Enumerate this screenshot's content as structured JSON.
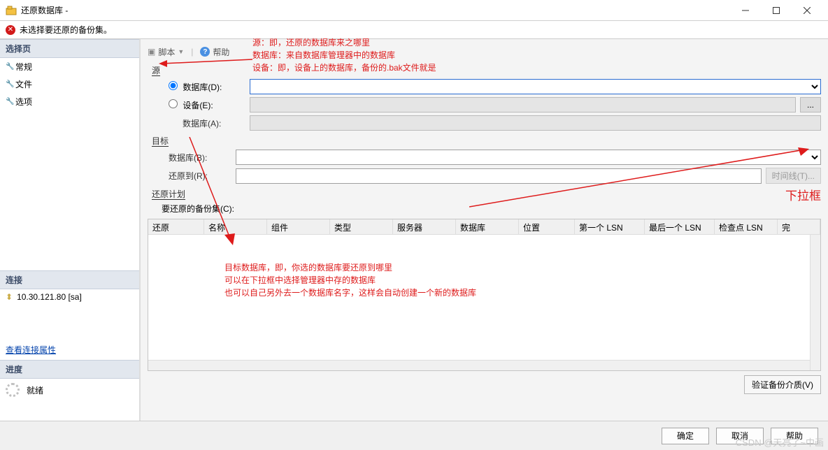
{
  "title": "还原数据库 -",
  "error_bar": "未选择要还原的备份集。",
  "sidebar": {
    "select_page": "选择页",
    "items": [
      "常规",
      "文件",
      "选项"
    ],
    "connection_header": "连接",
    "connection_text": "10.30.121.80 [sa]",
    "view_props_link": "查看连接属性",
    "progress_header": "进度",
    "progress_text": "就绪"
  },
  "toolbar": {
    "script": "脚本",
    "help": "帮助"
  },
  "source": {
    "header": "源",
    "db_radio": "数据库(D):",
    "device_radio": "设备(E):",
    "db_label": "数据库(A):"
  },
  "target": {
    "header": "目标",
    "db_label": "数据库(B):",
    "restore_to_label": "还原到(R):",
    "timeline_btn": "时间线(T)..."
  },
  "plan": {
    "header": "还原计划",
    "sets_label": "要还原的备份集(C):"
  },
  "table_columns": [
    "还原",
    "名称",
    "组件",
    "类型",
    "服务器",
    "数据库",
    "位置",
    "第一个 LSN",
    "最后一个 LSN",
    "检查点 LSN",
    "完"
  ],
  "verify_btn": "验证备份介质(V)",
  "buttons": {
    "ok": "确定",
    "cancel": "取消",
    "help": "帮助"
  },
  "annotations": {
    "top1": "源：即，还原的数据库来之哪里",
    "top2": "数据库：来自数据库管理器中的数据库",
    "top3": "设备：即，设备上的数据库，备份的.bak文件就是",
    "right_box": "下拉框",
    "mid1": "目标数据库，即，你选的数据库要还原到哪里",
    "mid2": "可以在下拉框中选择管理器中存的数据库",
    "mid3": "也可以自己另外去一个数据库名字，这样会自动创建一个新的数据库"
  },
  "watermark": "CSDN @天亮了~中画"
}
